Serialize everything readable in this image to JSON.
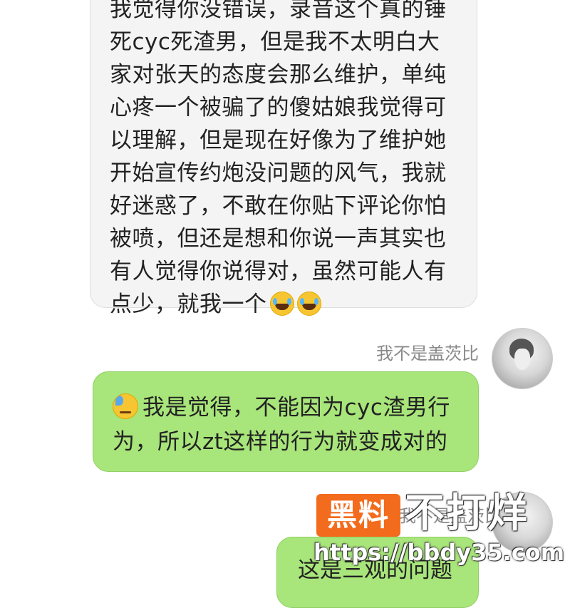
{
  "messages": [
    {
      "direction": "incoming",
      "lines": [
        "我觉得你没错误，录音这个真的锤",
        "死cyc死渣男，但是我不太明白大",
        "家对张天的态度会那么维护，单纯",
        "心疼一个被骗了的傻姑娘我觉得可",
        "以理解，但是现在好像为了维护她",
        "开始宣传约炮没问题的风气，我就",
        "好迷惑了，不敢在你贴下评论你怕",
        "被喷，但还是想和你说一声其实也",
        "有人觉得你说得对，虽然可能人有",
        "点少，就我一个"
      ],
      "trailing_emojis": [
        "joy-emoji",
        "joy-emoji"
      ]
    },
    {
      "direction": "outgoing",
      "sender": "我不是盖茨比",
      "leading_emoji": "sad-sweat-emoji",
      "lines": [
        "我是觉得，不能因为cyc渣男行",
        "为，所以zt这样的行为就变成对的"
      ]
    },
    {
      "direction": "outgoing",
      "sender": "我不是盖茨比",
      "lines": [
        "这是三观的问题"
      ]
    }
  ],
  "watermark": {
    "badge": "黑料",
    "title": "不打烊",
    "url": "https://bbdy35.com"
  },
  "colors": {
    "incoming_bubble": "#f4f4f4",
    "outgoing_bubble": "#a8e57a",
    "watermark_orange": "#f36b1c"
  }
}
